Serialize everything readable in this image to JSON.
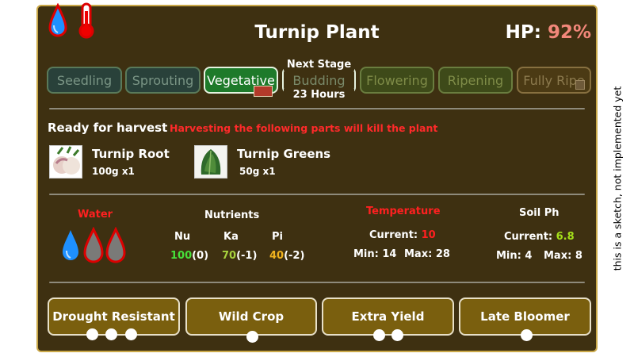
{
  "plant": {
    "title": "Turnip Plant",
    "hp_label": "HP:",
    "hp_value": "92%"
  },
  "status_icons": [
    "water-drop-icon",
    "thermometer-icon"
  ],
  "stages": {
    "past": [
      "Seedling",
      "Sprouting"
    ],
    "current": "Vegetative",
    "next": {
      "header": "Next Stage",
      "label": "Budding",
      "time": "23 Hours"
    },
    "future": [
      "Flowering",
      "Ripening",
      "Fully Ripe"
    ]
  },
  "harvest": {
    "ready_label": "Ready for harvest",
    "warning": "Harvesting the following parts will kill the plant",
    "items": [
      {
        "name": "Turnip Root",
        "amount": "100g x1"
      },
      {
        "name": "Turnip Greens",
        "amount": "50g x1"
      }
    ]
  },
  "water": {
    "label": "Water",
    "filled": 1,
    "total": 3
  },
  "nutrients": {
    "label": "Nutrients",
    "items": [
      {
        "abbr": "Nu",
        "value": "100",
        "delta": "(0)"
      },
      {
        "abbr": "Ka",
        "value": "70",
        "delta": "(-1)"
      },
      {
        "abbr": "Pi",
        "value": "40",
        "delta": "(-2)"
      }
    ]
  },
  "temperature": {
    "label": "Temperature",
    "current_label": "Current:",
    "current": "10",
    "min_label": "Min: 14",
    "max_label": "Max: 28"
  },
  "soil_ph": {
    "label": "Soil Ph",
    "current_label": "Current:",
    "current": "6.8",
    "min_label": "Min: 4",
    "max_label": "Max: 8"
  },
  "traits": [
    {
      "label": "Drought Resistant",
      "level": 3
    },
    {
      "label": "Wild Crop",
      "level": 1
    },
    {
      "label": "Extra Yield",
      "level": 2
    },
    {
      "label": "Late Bloomer",
      "level": 1
    }
  ],
  "colors": {
    "panel": "#3e3011",
    "border": "#caa848",
    "hp": "#f2877a",
    "warning": "#ff2020",
    "current_stage": "#1e7a2a"
  },
  "side_note": "this is a sketch, not implemented yet"
}
